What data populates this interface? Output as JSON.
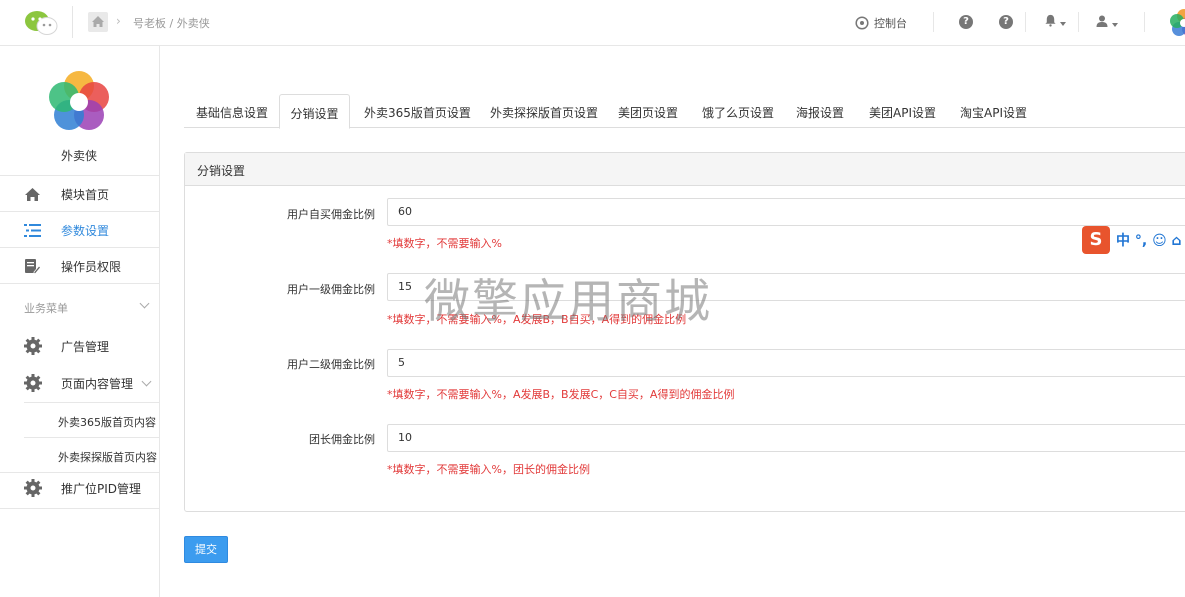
{
  "header": {
    "breadcrumb": "号老板 / 外卖侠",
    "console_label": "控制台",
    "help_icons": [
      "?",
      "?"
    ]
  },
  "sidebar": {
    "app_name": "外卖侠",
    "items": [
      {
        "label": "模块首页"
      },
      {
        "label": "参数设置"
      },
      {
        "label": "操作员权限"
      }
    ],
    "section_title": "业务菜单",
    "biz_items": [
      {
        "label": "广告管理"
      },
      {
        "label": "页面内容管理"
      }
    ],
    "sub_items": [
      {
        "label": "外卖365版首页内容"
      },
      {
        "label": "外卖探探版首页内容"
      }
    ],
    "pid_item": "推广位PID管理"
  },
  "tabs": [
    {
      "label": "基础信息设置"
    },
    {
      "label": "分销设置"
    },
    {
      "label": "外卖365版首页设置"
    },
    {
      "label": "外卖探探版首页设置"
    },
    {
      "label": "美团页设置"
    },
    {
      "label": "饿了么页设置"
    },
    {
      "label": "海报设置"
    },
    {
      "label": "美团API设置"
    },
    {
      "label": "淘宝API设置"
    }
  ],
  "panel": {
    "title": "分销设置",
    "fields": [
      {
        "label": "用户自买佣金比例",
        "value": "60",
        "hint": "*填数字，不需要输入%"
      },
      {
        "label": "用户一级佣金比例",
        "value": "15",
        "hint": "*填数字，不需要输入%，A发展B，B自买，A得到的佣金比例"
      },
      {
        "label": "用户二级佣金比例",
        "value": "5",
        "hint": "*填数字，不需要输入%，A发展B，B发展C，C自买，A得到的佣金比例"
      },
      {
        "label": "团长佣金比例",
        "value": "10",
        "hint": "*填数字，不需要输入%，团长的佣金比例"
      }
    ]
  },
  "submit_label": "提交",
  "watermark": "微擎应用商城",
  "ime": {
    "logo": "S",
    "text": "中 °, ☺ ⌂"
  },
  "colors": {
    "accent": "#3089dc",
    "hint": "#e23a3a",
    "button": "#3c9cef",
    "ime": "#e8542d"
  }
}
